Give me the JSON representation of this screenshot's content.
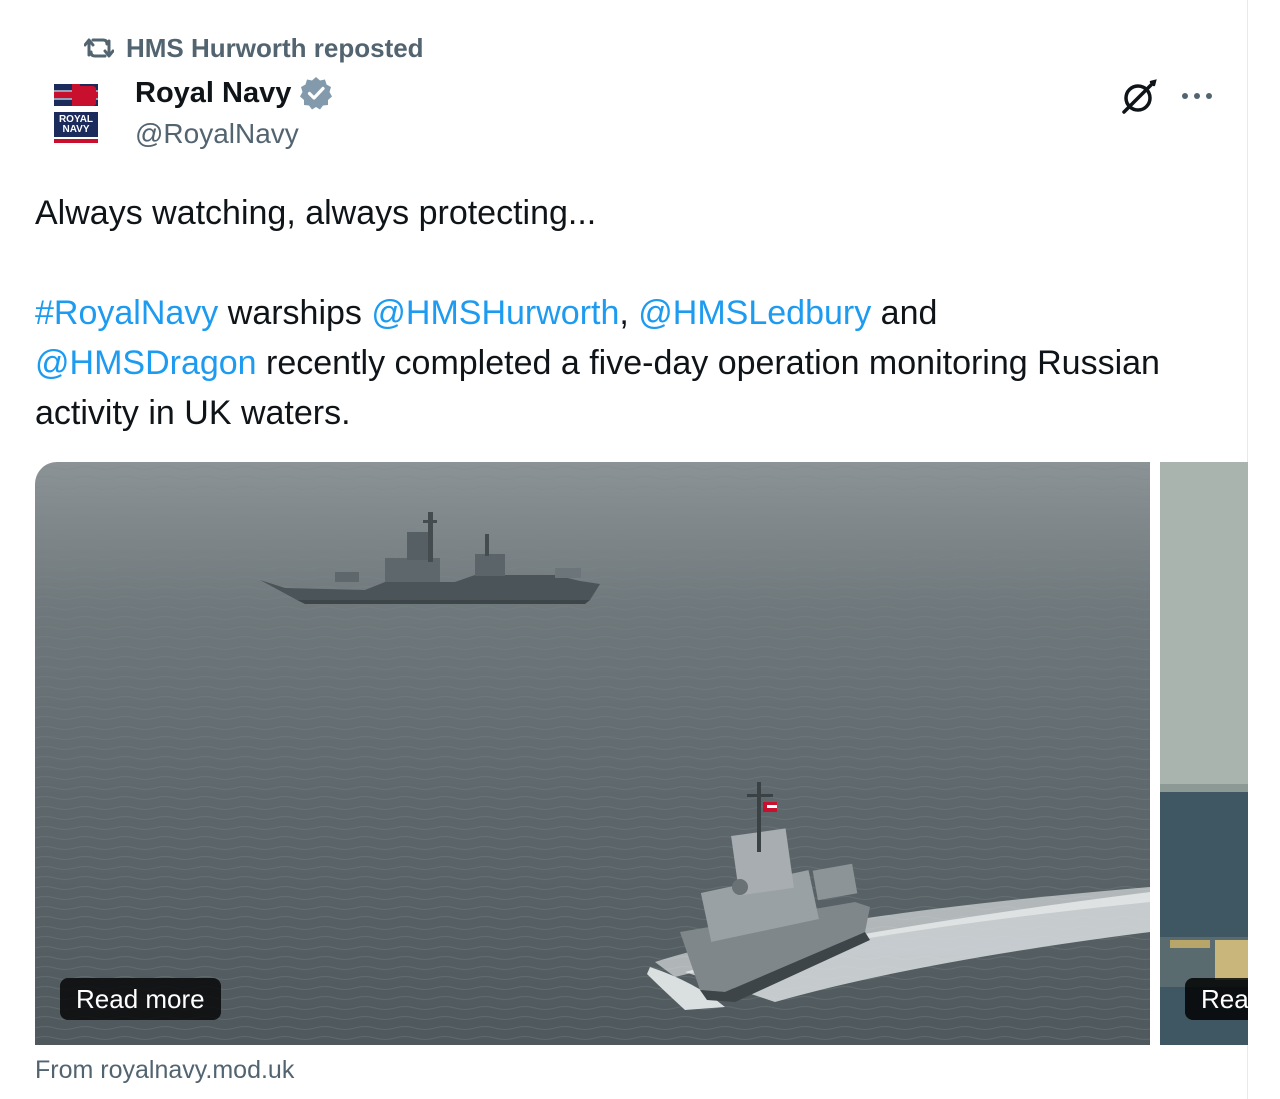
{
  "repost": {
    "icon": "repost-icon",
    "text": "HMS Hurworth reposted"
  },
  "author": {
    "avatar_text": "ROYAL NAVY",
    "display_name": "Royal Navy",
    "verified_icon": "verified-badge-icon",
    "handle": "@RoyalNavy"
  },
  "actions": {
    "grok_icon": "grok-icon",
    "more_icon": "more-icon"
  },
  "post": {
    "line1": "Always watching, always protecting...",
    "hashtag": "#RoyalNavy",
    "text_warships": " warships ",
    "mention1": "@HMSHurworth",
    "comma": ", ",
    "mention2": "@HMSLedbury",
    "text_and": " and",
    "mention3": "@HMSDragon",
    "text_rest": " recently completed a five-day operation monitoring Russian activity in UK waters."
  },
  "media": {
    "card1_button": "Read more",
    "card2_button": "Read more",
    "source": "From royalnavy.mod.uk"
  },
  "colors": {
    "link": "#1d9bf0",
    "verified": "#829aab",
    "secondary_text": "#536471"
  }
}
